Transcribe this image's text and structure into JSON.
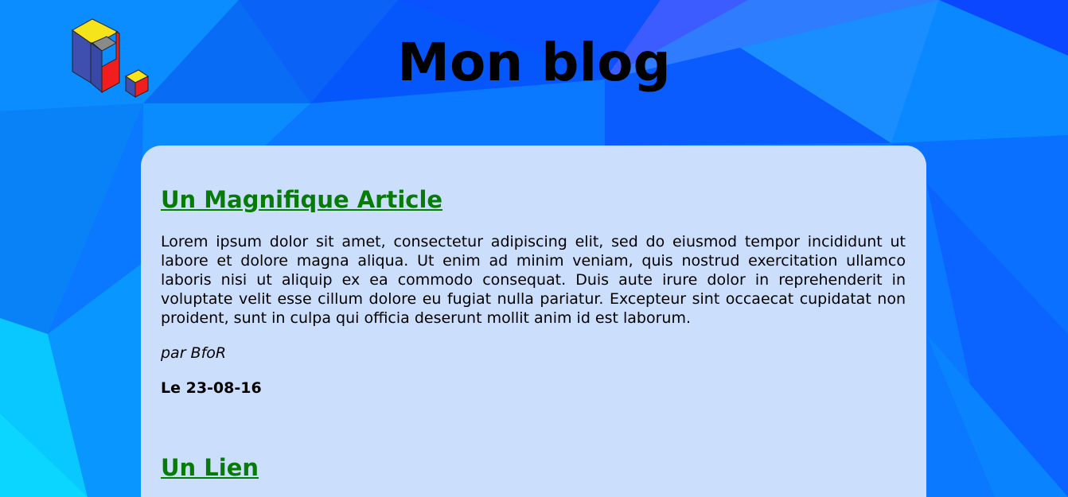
{
  "header": {
    "title": "Mon blog",
    "logo_icon": "cube-puzzle-logo-icon"
  },
  "colors": {
    "background": "#0a72ff",
    "panel": "#cbdffd",
    "article_title": "#067c06"
  },
  "articles": [
    {
      "title": "Un Magnifique Article",
      "body": "Lorem ipsum dolor sit amet, consectetur adipiscing elit, sed do eiusmod tempor incididunt ut labore et dolore magna aliqua. Ut enim ad minim veniam, quis nostrud exercitation ullamco laboris nisi ut aliquip ex ea commodo consequat. Duis aute irure dolor in reprehenderit in voluptate velit esse cillum dolore eu fugiat nulla pariatur. Excepteur sint occaecat cupidatat non proident, sunt in culpa qui officia deserunt mollit anim id est laborum.",
      "author": "par BfoR",
      "date": "Le 23-08-16"
    },
    {
      "title": "Un Lien"
    }
  ]
}
